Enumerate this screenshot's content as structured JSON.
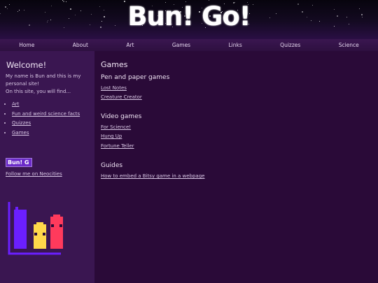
{
  "site": {
    "logo_text": "Bun! Go!"
  },
  "nav": {
    "items": [
      "Home",
      "About",
      "Art",
      "Games",
      "Links",
      "Quizzes",
      "Science"
    ]
  },
  "sidebar": {
    "heading": "Welcome!",
    "intro_line1": "My name is Bun and this is my personal site!",
    "intro_line2": "On this site, you will find...",
    "list": [
      "Art",
      "Fun and weird science facts",
      "Quizzes",
      "Games"
    ],
    "badge_text": "Bun! G",
    "follow_link": "Follow me on Neocities"
  },
  "main": {
    "title": "Games",
    "sections": [
      {
        "heading": "Pen and paper games",
        "links": [
          "Lost Notes",
          "Creature Creator"
        ]
      },
      {
        "heading": "Video games",
        "links": [
          "For Science!",
          "Hung Up",
          "Fortune Teller"
        ]
      },
      {
        "heading": "Guides",
        "links": [
          "How to embed a Bitsy game in a webpage"
        ]
      }
    ]
  },
  "colors": {
    "background": "#2a0a38",
    "sidebar": "#3a1651",
    "nav": "#3a1650",
    "badge": "#6b2bc8",
    "art_purple": "#6b1fff",
    "art_yellow": "#ffd84a",
    "art_red": "#ff3a5c"
  }
}
